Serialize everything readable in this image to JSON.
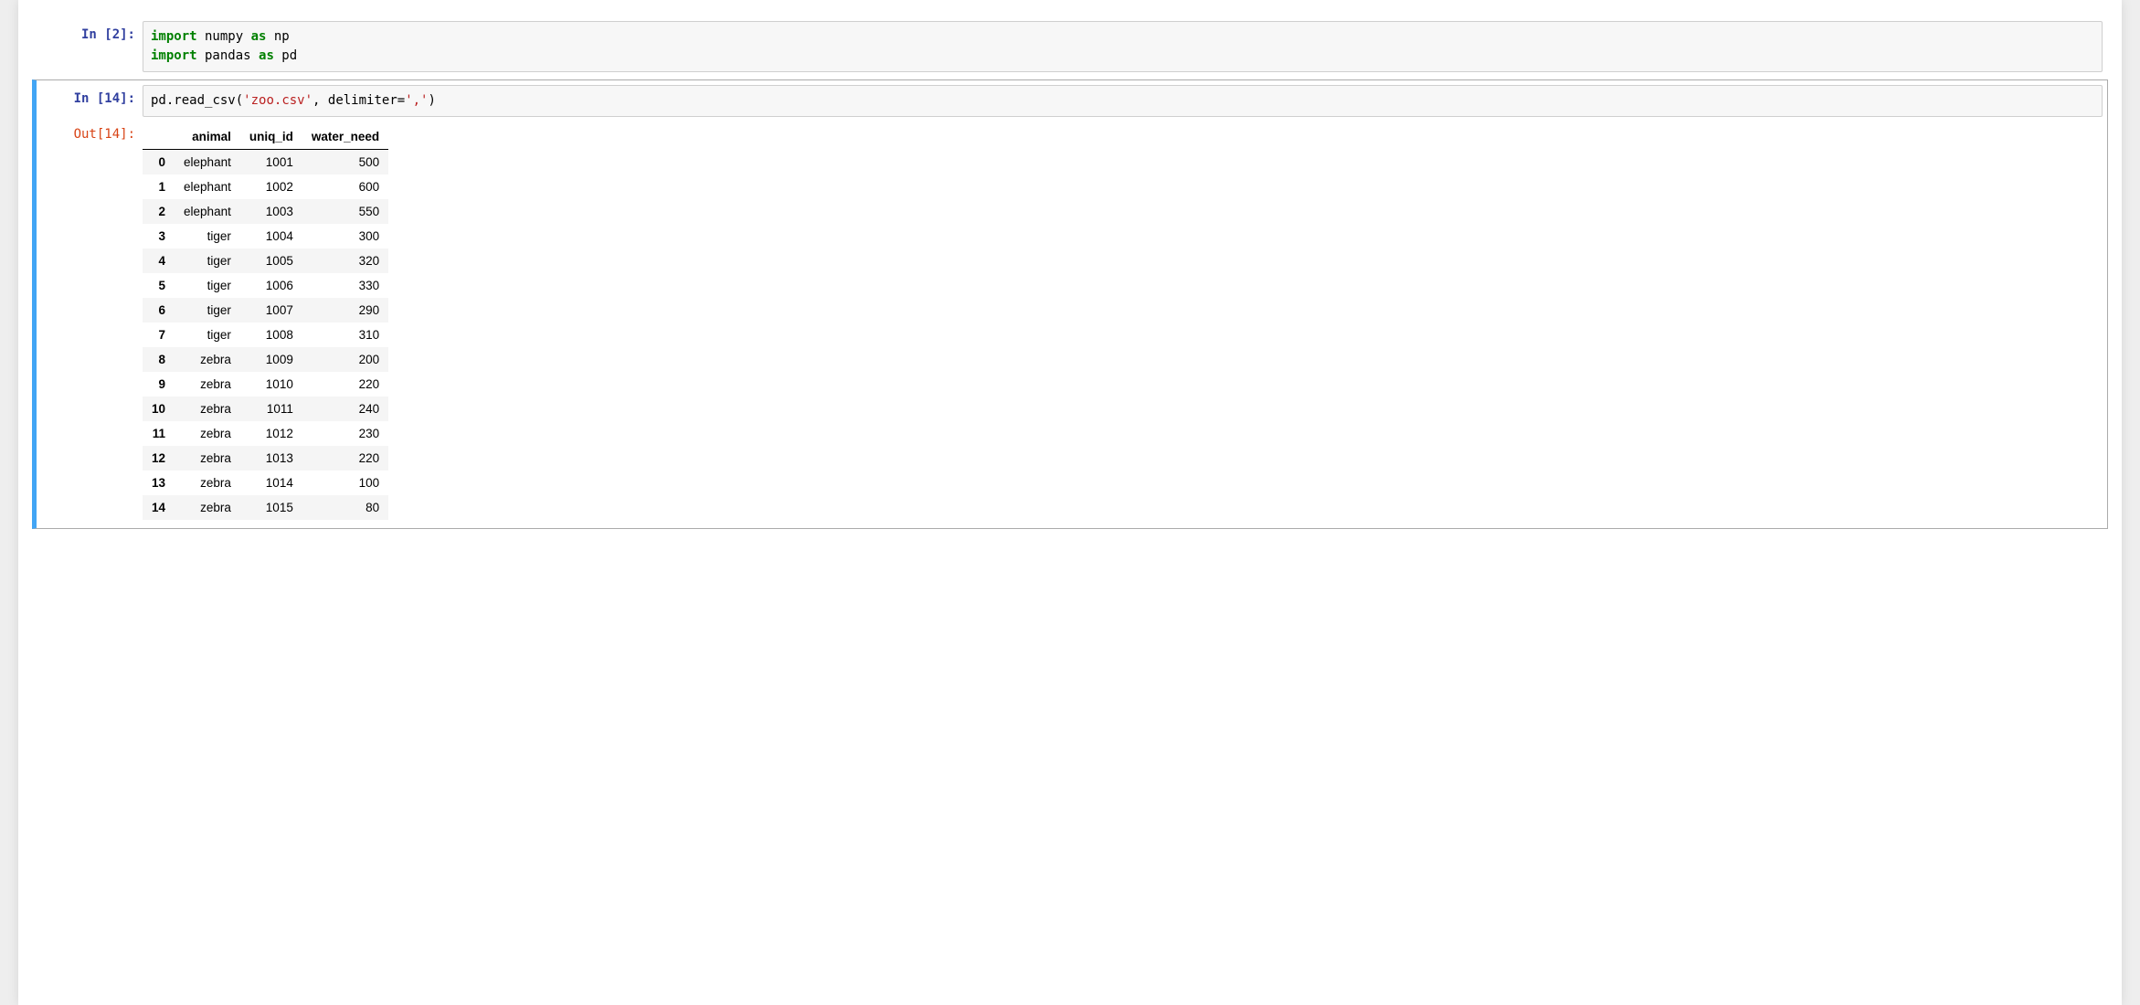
{
  "cells": {
    "cell1": {
      "prompt": "In [2]:",
      "code_tokens": [
        {
          "t": "import",
          "c": "kw"
        },
        {
          "t": " numpy ",
          "c": "nm"
        },
        {
          "t": "as",
          "c": "kw"
        },
        {
          "t": " np",
          "c": "nm"
        },
        {
          "t": "\n",
          "c": ""
        },
        {
          "t": "import",
          "c": "kw"
        },
        {
          "t": " pandas ",
          "c": "nm"
        },
        {
          "t": "as",
          "c": "kw"
        },
        {
          "t": " pd",
          "c": "nm"
        }
      ]
    },
    "cell2": {
      "prompt_in": "In [14]:",
      "prompt_out": "Out[14]:",
      "code_tokens": [
        {
          "t": "pd",
          "c": "nm"
        },
        {
          "t": ".",
          "c": "pn"
        },
        {
          "t": "read_csv",
          "c": "nm"
        },
        {
          "t": "(",
          "c": "pn"
        },
        {
          "t": "'zoo.csv'",
          "c": "str"
        },
        {
          "t": ",",
          "c": "pn"
        },
        {
          "t": " delimiter",
          "c": "nm"
        },
        {
          "t": "=",
          "c": "pn"
        },
        {
          "t": "','",
          "c": "str"
        },
        {
          "t": ")",
          "c": "pn"
        }
      ],
      "dataframe": {
        "columns": [
          "animal",
          "uniq_id",
          "water_need"
        ],
        "rows": [
          {
            "idx": "0",
            "vals": [
              "elephant",
              "1001",
              "500"
            ]
          },
          {
            "idx": "1",
            "vals": [
              "elephant",
              "1002",
              "600"
            ]
          },
          {
            "idx": "2",
            "vals": [
              "elephant",
              "1003",
              "550"
            ]
          },
          {
            "idx": "3",
            "vals": [
              "tiger",
              "1004",
              "300"
            ]
          },
          {
            "idx": "4",
            "vals": [
              "tiger",
              "1005",
              "320"
            ]
          },
          {
            "idx": "5",
            "vals": [
              "tiger",
              "1006",
              "330"
            ]
          },
          {
            "idx": "6",
            "vals": [
              "tiger",
              "1007",
              "290"
            ]
          },
          {
            "idx": "7",
            "vals": [
              "tiger",
              "1008",
              "310"
            ]
          },
          {
            "idx": "8",
            "vals": [
              "zebra",
              "1009",
              "200"
            ]
          },
          {
            "idx": "9",
            "vals": [
              "zebra",
              "1010",
              "220"
            ]
          },
          {
            "idx": "10",
            "vals": [
              "zebra",
              "1011",
              "240"
            ]
          },
          {
            "idx": "11",
            "vals": [
              "zebra",
              "1012",
              "230"
            ]
          },
          {
            "idx": "12",
            "vals": [
              "zebra",
              "1013",
              "220"
            ]
          },
          {
            "idx": "13",
            "vals": [
              "zebra",
              "1014",
              "100"
            ]
          },
          {
            "idx": "14",
            "vals": [
              "zebra",
              "1015",
              "80"
            ]
          }
        ]
      }
    }
  }
}
